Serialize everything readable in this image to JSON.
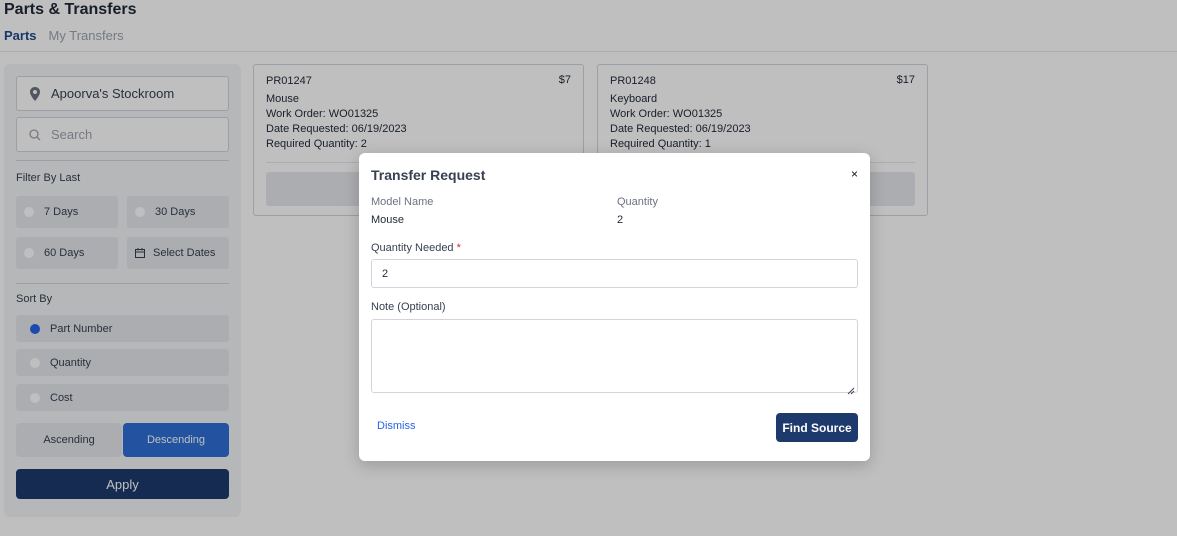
{
  "header": {
    "title": "Parts & Transfers",
    "tabs": [
      {
        "label": "Parts",
        "active": true
      },
      {
        "label": "My Transfers",
        "active": false
      }
    ]
  },
  "sidebar": {
    "location": "Apoorva's Stockroom",
    "search_placeholder": "Search",
    "filter_label": "Filter By Last",
    "filters": [
      "7 Days",
      "30 Days",
      "60 Days",
      "Select Dates"
    ],
    "sort_label": "Sort By",
    "sort_options": [
      {
        "label": "Part Number",
        "selected": true
      },
      {
        "label": "Quantity",
        "selected": false
      },
      {
        "label": "Cost",
        "selected": false
      }
    ],
    "order": {
      "ascending": "Ascending",
      "descending": "Descending",
      "selected": "Descending"
    },
    "apply_label": "Apply"
  },
  "cards": [
    {
      "part_number": "PR01247",
      "price": "$7",
      "name": "Mouse",
      "work_order_label": "Work Order:",
      "work_order": "WO01325",
      "date_label": "Date Requested:",
      "date": "06/19/2023",
      "qty_label": "Required Quantity:",
      "qty": "2"
    },
    {
      "part_number": "PR01248",
      "price": "$17",
      "name": "Keyboard",
      "work_order_label": "Work Order:",
      "work_order": "WO01325",
      "date_label": "Date Requested:",
      "date": "06/19/2023",
      "qty_label": "Required Quantity:",
      "qty": "1"
    }
  ],
  "modal": {
    "title": "Transfer Request",
    "close": "×",
    "model_name_label": "Model Name",
    "model_name": "Mouse",
    "quantity_label": "Quantity",
    "quantity": "2",
    "qty_needed_label": "Quantity Needed",
    "required_mark": "*",
    "qty_needed_value": "2",
    "note_label": "Note (Optional)",
    "note_value": "",
    "dismiss_label": "Dismiss",
    "find_label": "Find Source"
  },
  "colors": {
    "primary": "#1e3a6d",
    "accent": "#2f6fd6",
    "link": "#2563eb",
    "required": "#dc2626"
  }
}
